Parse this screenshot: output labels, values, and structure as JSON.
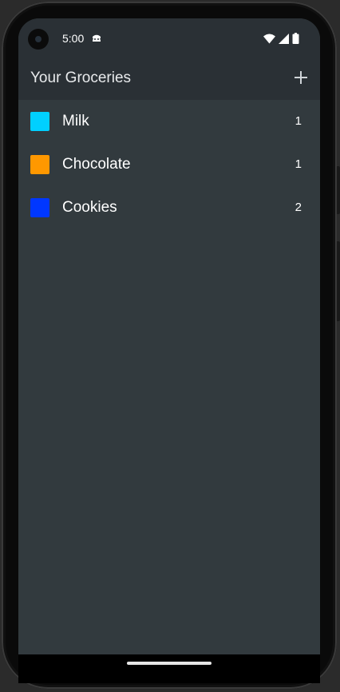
{
  "status_bar": {
    "time": "5:00",
    "notification_icon": "android-head-icon",
    "icons": [
      "wifi-icon",
      "cellular-signal-icon",
      "battery-icon"
    ]
  },
  "app_bar": {
    "title": "Your Groceries",
    "add_icon": "plus-icon"
  },
  "groceries": [
    {
      "name": "Milk",
      "quantity": "1",
      "color": "#00d0ff"
    },
    {
      "name": "Chocolate",
      "quantity": "1",
      "color": "#ff9800"
    },
    {
      "name": "Cookies",
      "quantity": "2",
      "color": "#0037ff"
    }
  ],
  "colors": {
    "background": "#323a3e",
    "app_bar": "#2a3035",
    "text": "#ffffff"
  }
}
